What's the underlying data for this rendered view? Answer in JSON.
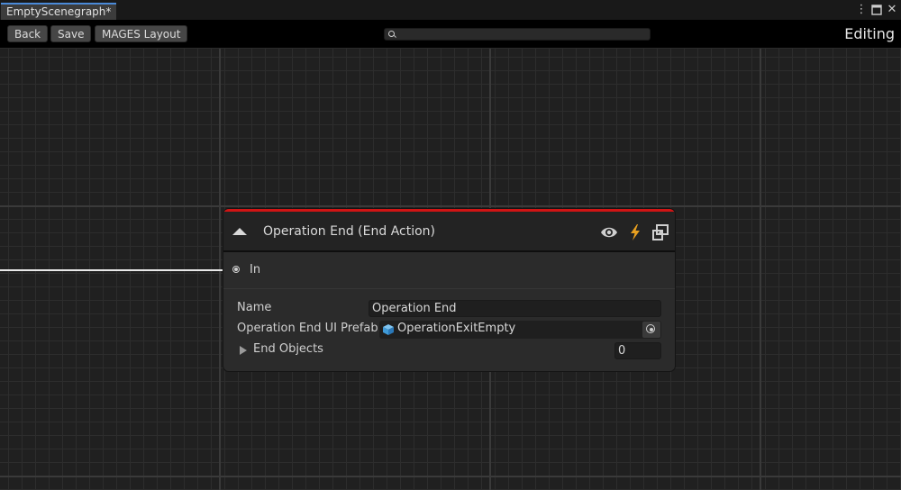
{
  "window": {
    "tab_title": "EmptyScenegraph*",
    "menu_icon": "kebab-menu-icon",
    "maximize_icon": "maximize-icon",
    "close_icon": "close-icon"
  },
  "toolbar": {
    "back_label": "Back",
    "save_label": "Save",
    "layout_label": "MAGES Layout",
    "search_value": "",
    "mode_label": "Editing"
  },
  "node": {
    "title": "Operation End (End Action)",
    "accent_color": "#d01414",
    "header_icons": [
      "visibility-eye-icon",
      "lightning-icon",
      "window-link-icon"
    ],
    "input_port_label": "In",
    "fields": {
      "name_label": "Name",
      "name_value": "Operation End",
      "prefab_label": "Operation End UI Prefab",
      "prefab_value": "OperationExitEmpty",
      "end_objects_label": "End Objects",
      "end_objects_count": "0"
    }
  }
}
